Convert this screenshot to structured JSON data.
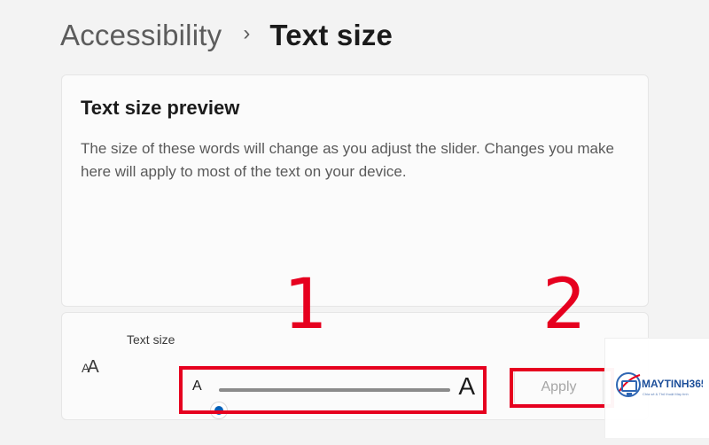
{
  "breadcrumb": {
    "parent": "Accessibility",
    "separator": "›",
    "current": "Text size"
  },
  "preview": {
    "title": "Text size preview",
    "description": "The size of these words will change as you adjust the slider. Changes you make here will apply to most of the text on your device."
  },
  "text_size_control": {
    "label": "Text size",
    "icon": "text-size-icon",
    "min_label": "A",
    "max_label": "A",
    "slider": {
      "value": 100,
      "min": 100,
      "max": 225
    },
    "apply_label": "Apply"
  },
  "annotations": [
    {
      "label": "1"
    },
    {
      "label": "2"
    }
  ],
  "watermark": {
    "brand": "MAYTINH365",
    "tagline": "Chia sẻ & Thủ thuật Máy tính"
  },
  "colors": {
    "accent": "#005fb8",
    "annotation": "#e6001f",
    "page_background": "#f3f3f3",
    "card_background": "#fbfbfb"
  }
}
